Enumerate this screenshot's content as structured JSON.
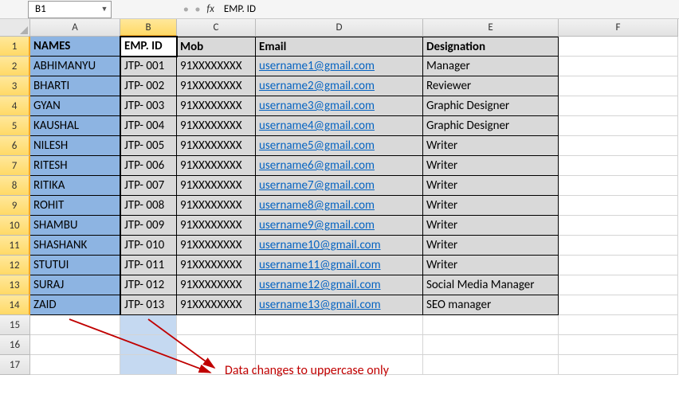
{
  "namebox": {
    "cellref": "B1",
    "formula": "EMP. ID",
    "fx_label": "fx"
  },
  "columns": [
    "A",
    "B",
    "C",
    "D",
    "E",
    "F"
  ],
  "headers": {
    "A": "NAMES",
    "B": "EMP. ID",
    "C": "Mob",
    "D": "Email",
    "E": "Designation"
  },
  "rows": [
    {
      "A": "ABHIMANYU",
      "B": "JTP- 001",
      "C": "91XXXXXXXX",
      "D": "username1@gmail.com",
      "E": "Manager"
    },
    {
      "A": "BHARTI",
      "B": "JTP- 002",
      "C": "91XXXXXXXX",
      "D": "username2@gmail.com",
      "E": "Reviewer"
    },
    {
      "A": "GYAN",
      "B": "JTP- 003",
      "C": "91XXXXXXXX",
      "D": "username3@gmail.com",
      "E": "Graphic Designer"
    },
    {
      "A": "KAUSHAL",
      "B": "JTP- 004",
      "C": "91XXXXXXXX",
      "D": "username4@gmail.com",
      "E": "Graphic Designer"
    },
    {
      "A": "NILESH",
      "B": "JTP- 005",
      "C": "91XXXXXXXX",
      "D": "username5@gmail.com",
      "E": "Writer"
    },
    {
      "A": "RITESH",
      "B": "JTP- 006",
      "C": "91XXXXXXXX",
      "D": "username6@gmail.com",
      "E": "Writer"
    },
    {
      "A": "RITIKA",
      "B": "JTP- 007",
      "C": "91XXXXXXXX",
      "D": "username7@gmail.com",
      "E": "Writer"
    },
    {
      "A": "ROHIT",
      "B": "JTP- 008",
      "C": "91XXXXXXXX",
      "D": "username8@gmail.com",
      "E": "Writer"
    },
    {
      "A": "SHAMBU",
      "B": "JTP- 009",
      "C": "91XXXXXXXX",
      "D": "username9@gmail.com",
      "E": "Writer"
    },
    {
      "A": "SHASHANK",
      "B": "JTP- 010",
      "C": "91XXXXXXXX",
      "D": "username10@gmail.com",
      "E": "Writer"
    },
    {
      "A": "STUTUI",
      "B": "JTP- 011",
      "C": "91XXXXXXXX",
      "D": "username11@gmail.com",
      "E": "Writer"
    },
    {
      "A": "SURAJ",
      "B": "JTP- 012",
      "C": "91XXXXXXXX",
      "D": "username12@gmail.com",
      "E": "Social Media Manager"
    },
    {
      "A": "ZAID",
      "B": "JTP- 013",
      "C": "91XXXXXXXX",
      "D": "username13@gmail.com",
      "E": "SEO manager"
    }
  ],
  "blank_rows": [
    15,
    16,
    17
  ],
  "annotation_text": "Data changes to uppercase only"
}
